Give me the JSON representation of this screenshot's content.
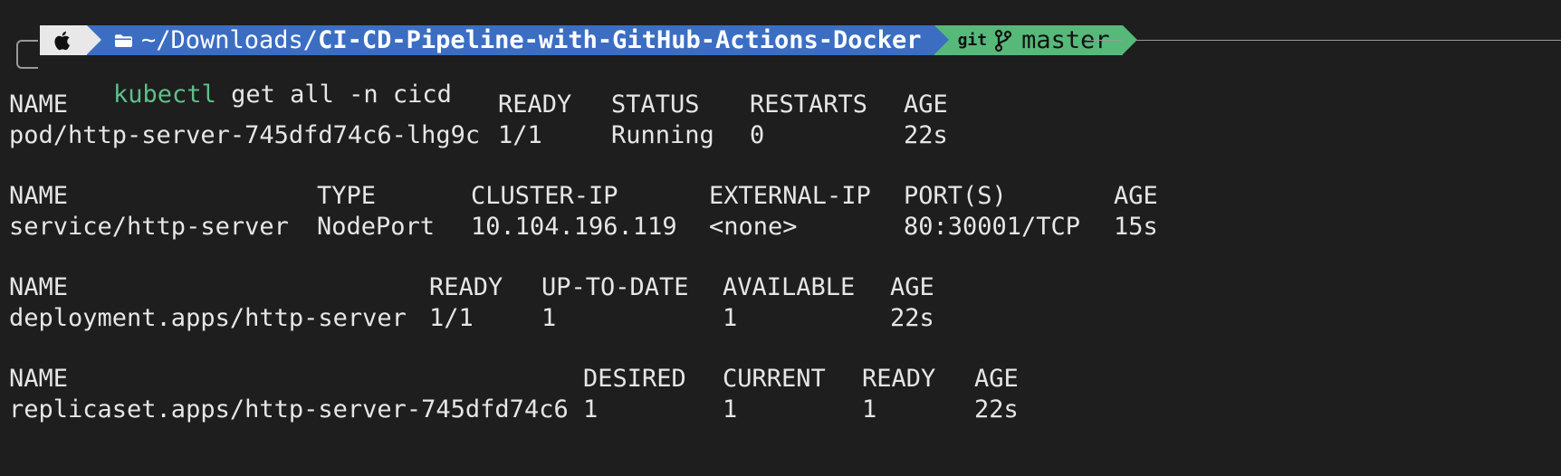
{
  "prompt": {
    "os_icon": "apple-icon",
    "folder_icon": "folder-icon",
    "dir_prefix": "~/Downloads/",
    "dir_name": "CI-CD-Pipeline-with-GitHub-Actions-Docker",
    "git_label": "git",
    "branch_icon": "git-branch-icon",
    "branch": "master",
    "colors": {
      "os_bg": "#e8e8e8",
      "dir_bg": "#3b6ec3",
      "git_bg": "#56b97a",
      "command": "#5fbf8a"
    }
  },
  "command": {
    "name": "kubectl",
    "args": " get all -n cicd"
  },
  "tables": {
    "pods": {
      "headers": [
        "NAME",
        "READY",
        "STATUS",
        "RESTARTS",
        "AGE"
      ],
      "rows": [
        [
          "pod/http-server-745dfd74c6-lhg9c",
          "1/1",
          "Running",
          "0",
          "22s"
        ]
      ]
    },
    "services": {
      "headers": [
        "NAME",
        "TYPE",
        "CLUSTER-IP",
        "EXTERNAL-IP",
        "PORT(S)",
        "AGE"
      ],
      "rows": [
        [
          "service/http-server",
          "NodePort",
          "10.104.196.119",
          "<none>",
          "80:30001/TCP",
          "15s"
        ]
      ]
    },
    "deployments": {
      "headers": [
        "NAME",
        "READY",
        "UP-TO-DATE",
        "AVAILABLE",
        "AGE"
      ],
      "rows": [
        [
          "deployment.apps/http-server",
          "1/1",
          "1",
          "1",
          "22s"
        ]
      ]
    },
    "replicasets": {
      "headers": [
        "NAME",
        "DESIRED",
        "CURRENT",
        "READY",
        "AGE"
      ],
      "rows": [
        [
          "replicaset.apps/http-server-745dfd74c6",
          "1",
          "1",
          "1",
          "22s"
        ]
      ]
    }
  }
}
